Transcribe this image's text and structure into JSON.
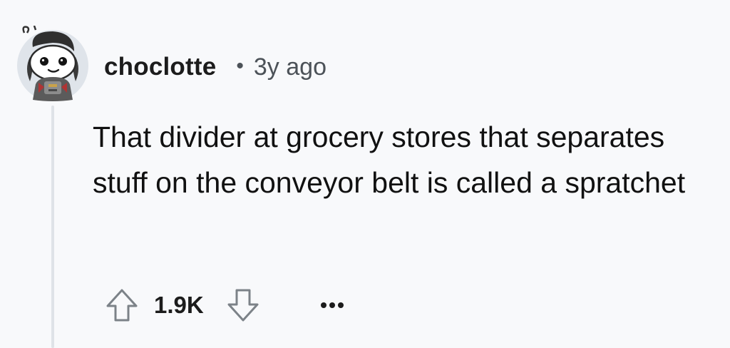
{
  "comment": {
    "author": "choclotte",
    "separator": "•",
    "timestamp": "3y ago",
    "body": "That divider at grocery stores that separates stuff on the conveyor belt is called a spratchet",
    "score": "1.9K"
  },
  "icons": {
    "avatar": "snoo-avatar-icon",
    "upvote": "upvote-arrow-icon",
    "downvote": "downvote-arrow-icon",
    "more": "more-options-icon"
  },
  "colors": {
    "background": "#f8f9fb",
    "text": "#111111",
    "muted": "#4c5258",
    "thread_line": "#dfe3e8",
    "icon_stroke": "#7c8288"
  }
}
